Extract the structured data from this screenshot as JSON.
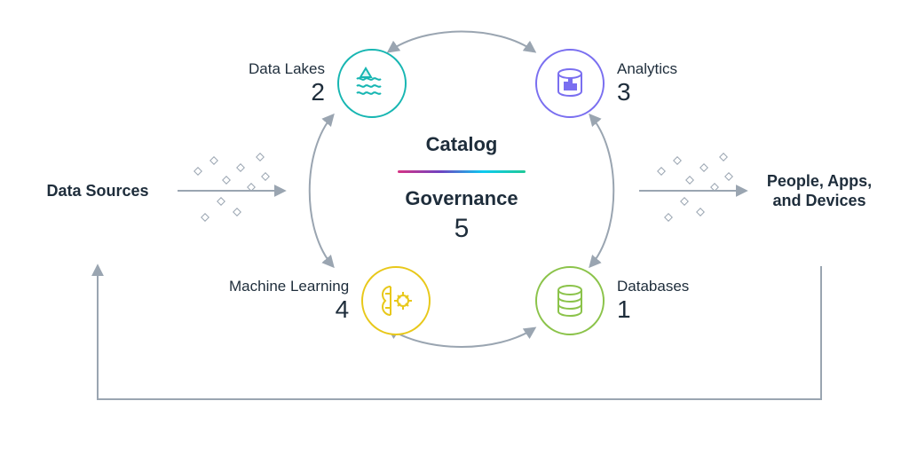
{
  "left_endpoint": {
    "label": "Data Sources"
  },
  "right_endpoint": {
    "label": "People, Apps, and Devices"
  },
  "center": {
    "top": "Catalog",
    "bottom": "Governance",
    "number": "5"
  },
  "nodes": {
    "data_lakes": {
      "label": "Data Lakes",
      "number": "2",
      "color": "#17b6b2"
    },
    "analytics": {
      "label": "Analytics",
      "number": "3",
      "color": "#7a6ff0"
    },
    "machine_learning": {
      "label": "Machine Learning",
      "number": "4",
      "color": "#e8c81a"
    },
    "databases": {
      "label": "Databases",
      "number": "1",
      "color": "#8bc34a"
    }
  }
}
